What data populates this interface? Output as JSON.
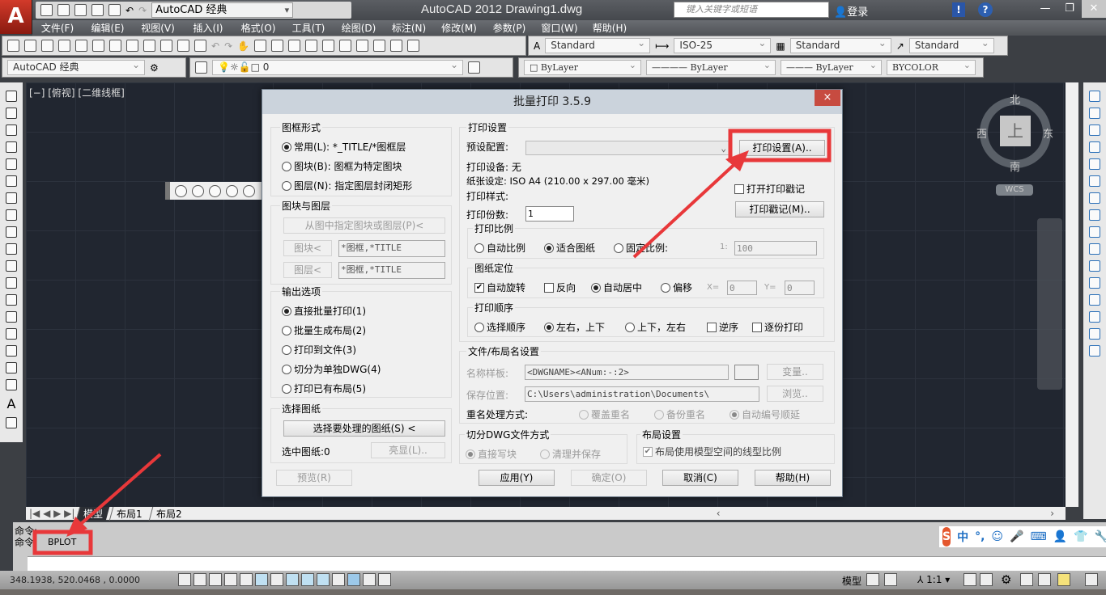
{
  "app": {
    "title": "AutoCAD 2012    Drawing1.dwg",
    "logo": "A",
    "workspace": "AutoCAD 经典",
    "search_placeholder": "键入关键字或短语",
    "login": "登录"
  },
  "menu": [
    "文件(F)",
    "编辑(E)",
    "视图(V)",
    "插入(I)",
    "格式(O)",
    "工具(T)",
    "绘图(D)",
    "标注(N)",
    "修改(M)",
    "参数(P)",
    "窗口(W)",
    "帮助(H)"
  ],
  "styles": {
    "text_style": "Standard",
    "dim_style": "ISO-25",
    "table_style": "Standard",
    "mleader_style": "Standard"
  },
  "layers": {
    "workspace": "AutoCAD 经典",
    "current_layer": "0",
    "color": "ByLayer",
    "linetype": "ByLayer",
    "lineweight": "ByLayer",
    "plot_style": "BYCOLOR"
  },
  "viewport": {
    "label": "[−] [俯视] [二维线框]",
    "compass": {
      "n": "北",
      "s": "南",
      "e": "东",
      "w": "西",
      "top": "上"
    },
    "wcs": "WCS"
  },
  "layout_tabs": [
    "模型",
    "布局1",
    "布局2"
  ],
  "command": {
    "line1": "命令:",
    "line2": "命令:",
    "value": "BPLOT"
  },
  "ime": {
    "logo": "S",
    "mode": "中",
    "punct": "°,"
  },
  "status": {
    "coords": "348.1938,  520.0468 , 0.0000",
    "model": "模型",
    "scale": "1:1"
  },
  "dialog": {
    "title": "批量打印 3.5.9",
    "close": "×",
    "frame": {
      "title": "图框形式",
      "options": [
        "常用(L): *_TITLE/*图框层",
        "图块(B): 图框为特定图块",
        "图层(N): 指定图层封闭矩形"
      ],
      "selected": 0
    },
    "blocklayer": {
      "title": "图块与图层",
      "pick": "从图中指定图块或图层(P)<",
      "block_btn": "图块<",
      "block_val": "*图框,*TITLE",
      "layer_btn": "图层<",
      "layer_val": "*图框,*TITLE"
    },
    "output": {
      "title": "输出选项",
      "options": [
        "直接批量打印(1)",
        "批量生成布局(2)",
        "打印到文件(3)",
        "切分为单独DWG(4)",
        "打印已有布局(5)"
      ],
      "selected": 0
    },
    "select": {
      "title": "选择图纸",
      "btn": "选择要处理的图纸(S) <",
      "count_label": "选中图纸:0",
      "highlight": "亮显(L).."
    },
    "preview": "预览(R)",
    "print": {
      "title": "打印设置",
      "preset_label": "预设配置:",
      "preset_value": "",
      "setup_btn": "打印设置(A)..",
      "device": "打印设备: 无",
      "paper": "纸张设定: ISO A4 (210.00 x 297.00 毫米)",
      "style": "打印样式:",
      "stamp_check": "打开打印戳记",
      "stamp_checked": false,
      "stamp_btn": "打印戳记(M)..",
      "copies_label": "打印份数:",
      "copies": "1"
    },
    "scale": {
      "title": "打印比例",
      "options": [
        "自动比例",
        "适合图纸",
        "固定比例:"
      ],
      "selected": 1,
      "ratio_label": "1:",
      "ratio": "100"
    },
    "position": {
      "title": "图纸定位",
      "auto_rotate": "自动旋转",
      "auto_rotate_checked": true,
      "reverse": "反向",
      "reverse_checked": false,
      "options": [
        "自动居中",
        "偏移"
      ],
      "selected": 0,
      "x_label": "X=",
      "x": "0",
      "y_label": "Y=",
      "y": "0"
    },
    "order": {
      "title": "打印顺序",
      "options": [
        "选择顺序",
        "左右，上下",
        "上下，左右"
      ],
      "selected": 1,
      "reverse": "逆序",
      "collate": "逐份打印"
    },
    "file": {
      "title": "文件/布局名设置",
      "template_label": "名称样板:",
      "template": "<DWGNAME><ANum:-:2>",
      "var_btn": "变量..",
      "save_label": "保存位置:",
      "save_path": "C:\\Users\\administration\\Documents\\",
      "browse_btn": "浏览..",
      "rename_label": "重名处理方式:",
      "rename_options": [
        "覆盖重名",
        "备份重名",
        "自动编号顺延"
      ],
      "rename_selected": 2
    },
    "split": {
      "title": "切分DWG文件方式",
      "options": [
        "直接写块",
        "清理并保存"
      ],
      "selected": 0
    },
    "layout": {
      "title": "布局设置",
      "check": "布局使用模型空间的线型比例",
      "checked": true
    },
    "buttons": {
      "apply": "应用(Y)",
      "ok": "确定(O)",
      "cancel": "取消(C)",
      "help": "帮助(H)"
    }
  },
  "colors": {
    "annotation": "#e8383a",
    "canvas": "#212630",
    "dialog_bg": "#f0f0f0"
  }
}
